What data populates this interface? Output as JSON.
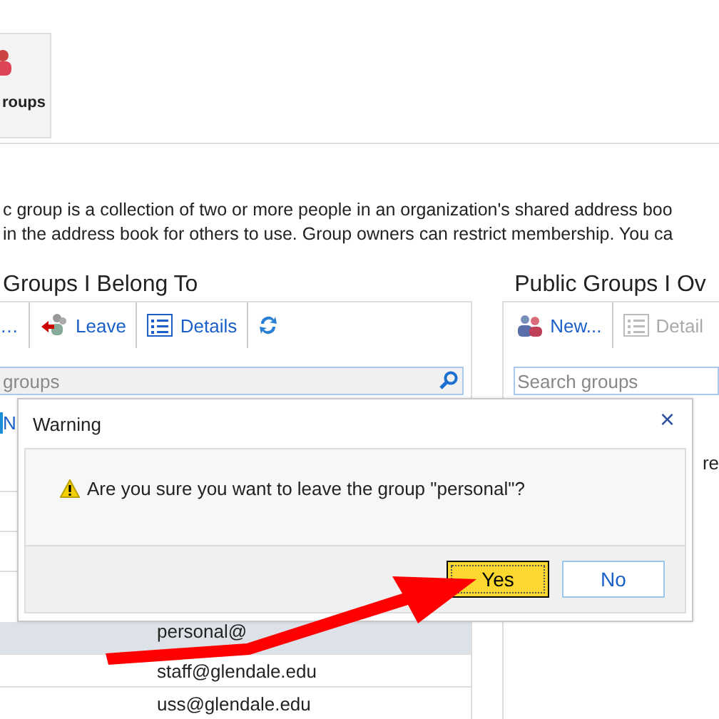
{
  "ribbon": {
    "button_label": "roups"
  },
  "description": [
    "c group is a collection of two or more people in an organization's shared address boo",
    "in the address book for others to use. Group owners can restrict membership. You ca"
  ],
  "left_panel": {
    "title": "Groups I Belong To",
    "toolbar": [
      {
        "kind": "text",
        "label": "…"
      },
      {
        "kind": "leave",
        "label": "Leave"
      },
      {
        "kind": "details",
        "label": "Details"
      },
      {
        "kind": "refresh"
      }
    ],
    "search": {
      "placeholder": "groups"
    },
    "column_1": "N",
    "rows": [
      {
        "text": "personal@",
        "selected": true
      },
      {
        "text": "staff@glendale.edu",
        "selected": false
      },
      {
        "text": "uss@glendale.edu",
        "selected": false
      }
    ]
  },
  "right_panel": {
    "title": "Public Groups I Ov",
    "toolbar": [
      {
        "kind": "new",
        "label": "New...",
        "disabled": false
      },
      {
        "kind": "details",
        "label": "Detail",
        "disabled": true
      }
    ],
    "search": {
      "placeholder": "Search groups"
    },
    "rows": [
      {
        "text": "re"
      }
    ]
  },
  "dialog": {
    "title": "Warning",
    "close": "×",
    "message": "Are you sure you want to leave the group \"personal\"?",
    "buttons": [
      {
        "label": "Yes",
        "selected": true
      },
      {
        "label": "No",
        "selected": false
      }
    ]
  }
}
